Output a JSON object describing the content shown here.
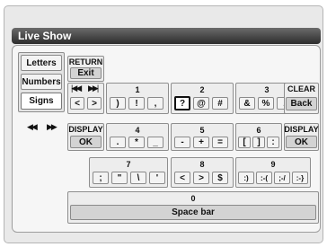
{
  "window": {
    "title": "Live Show"
  },
  "tabs": [
    {
      "label": "Letters"
    },
    {
      "label": "Numbers"
    },
    {
      "label": "Signs"
    }
  ],
  "tab_nav": {
    "prev": "◀◀",
    "next": "▶▶"
  },
  "return_group": {
    "label": "RETURN",
    "button": "Exit"
  },
  "nav_group": {
    "start": "|◀◀",
    "end": "▶▶|",
    "left": "<",
    "right": ">"
  },
  "clear_group": {
    "label": "CLEAR",
    "button": "Back"
  },
  "display_left": {
    "label": "DISPLAY",
    "button": "OK"
  },
  "display_right": {
    "label": "DISPLAY",
    "button": "OK"
  },
  "key_groups": [
    {
      "number": "1",
      "keys": [
        ")",
        "!",
        ","
      ]
    },
    {
      "number": "2",
      "keys": [
        "?",
        "@",
        "#"
      ]
    },
    {
      "number": "3",
      "keys": [
        "&",
        "%",
        "/"
      ]
    },
    {
      "number": "4",
      "keys": [
        ".",
        "*",
        "_"
      ]
    },
    {
      "number": "5",
      "keys": [
        "-",
        "+",
        "="
      ]
    },
    {
      "number": "6",
      "keys": [
        "[",
        "]",
        ":"
      ]
    },
    {
      "number": "7",
      "keys": [
        ";",
        "\"",
        "\\",
        "'"
      ]
    },
    {
      "number": "8",
      "keys": [
        "<",
        ">",
        "$"
      ]
    },
    {
      "number": "9",
      "keys": [
        ":)",
        ":-(",
        ";-/",
        ":-}"
      ]
    },
    {
      "number": "0",
      "keys": [
        "Space bar"
      ]
    }
  ],
  "selected_key": "?"
}
